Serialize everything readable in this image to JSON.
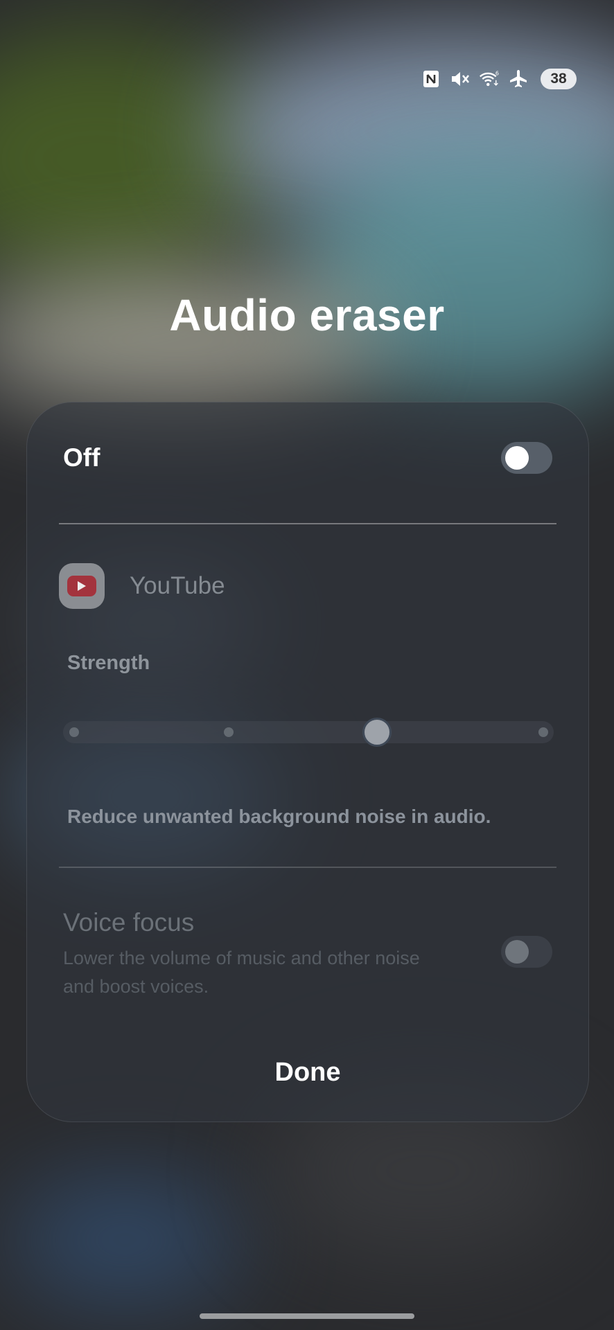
{
  "status_bar": {
    "icons": [
      "nfc-icon",
      "mute-icon",
      "wifi-6-icon",
      "airplane-mode-icon"
    ],
    "wifi_badge": "6",
    "battery": "38"
  },
  "page_title": "Audio eraser",
  "panel": {
    "master_toggle": {
      "label": "Off",
      "state": "off"
    },
    "app": {
      "name": "YouTube",
      "icon": "youtube-icon"
    },
    "strength": {
      "label": "Strength",
      "steps": 4,
      "selected_step": 3
    },
    "description": "Reduce unwanted background noise in audio.",
    "voice_focus": {
      "title": "Voice focus",
      "subtitle": "Lower the volume of music and other noise and boost voices.",
      "state": "off"
    },
    "done_label": "Done"
  },
  "colors": {
    "panel_bg": "#30363d",
    "toggle_knob": "#ffffff",
    "youtube_red": "#a3333d"
  }
}
